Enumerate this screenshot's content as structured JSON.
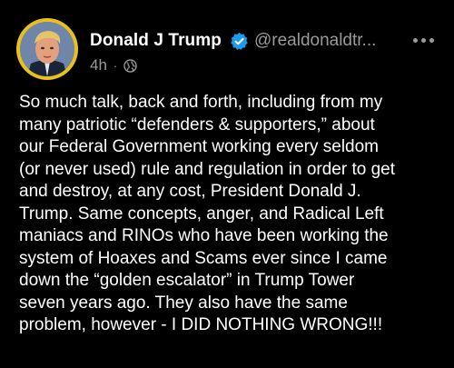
{
  "post": {
    "author": {
      "display_name": "Donald J Trump",
      "handle": "@realdonaldtr...",
      "verified": true,
      "avatar_icon": "avatar-photo-icon"
    },
    "timestamp": "4h",
    "separator": "·",
    "visibility_icon": "globe-icon",
    "more_icon": "more-options-icon",
    "text": "So much talk, back and forth, including from my\nmany patriotic “defenders & supporters,” about\nour Federal Government working every seldom\n(or never used) rule and regulation in order to get\nand destroy, at any cost, President Donald J.\nTrump. Same concepts, anger, and Radical Left\nmaniacs and RINOs who have been working the\nsystem of Hoaxes and Scams ever since I came\ndown the “golden escalator” in Trump Tower\nseven years ago. They also have the same\nproblem, however - I DID NOTHING WRONG!!!"
  },
  "colors": {
    "background": "#000000",
    "text_primary": "#ffffff",
    "text_secondary": "#9a9a9a",
    "verified_badge": "#1d9bf0",
    "avatar_ring": "#e9c11a"
  }
}
